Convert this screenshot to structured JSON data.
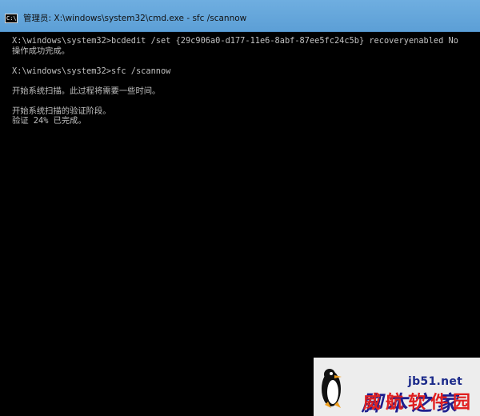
{
  "window": {
    "title": "管理员: X:\\windows\\system32\\cmd.exe - sfc  /scannow",
    "icon_name": "cmd-icon",
    "icon_text": "C:\\"
  },
  "console": {
    "text_color": "#c0c0c0",
    "background": "#000000",
    "lines": [
      "X:\\windows\\system32>bcdedit /set {29c906a0-d177-11e6-8abf-87ee5fc24c5b} recoveryenabled No",
      "操作成功完成。",
      "",
      "X:\\windows\\system32>sfc /scannow",
      "",
      "开始系统扫描。此过程将需要一些时间。",
      "",
      "开始系统扫描的验证阶段。",
      "验证 24% 已完成。"
    ]
  },
  "watermark": {
    "site": "jb51.net",
    "name_blue": "脚本之家",
    "name_red": "威航软件园"
  }
}
